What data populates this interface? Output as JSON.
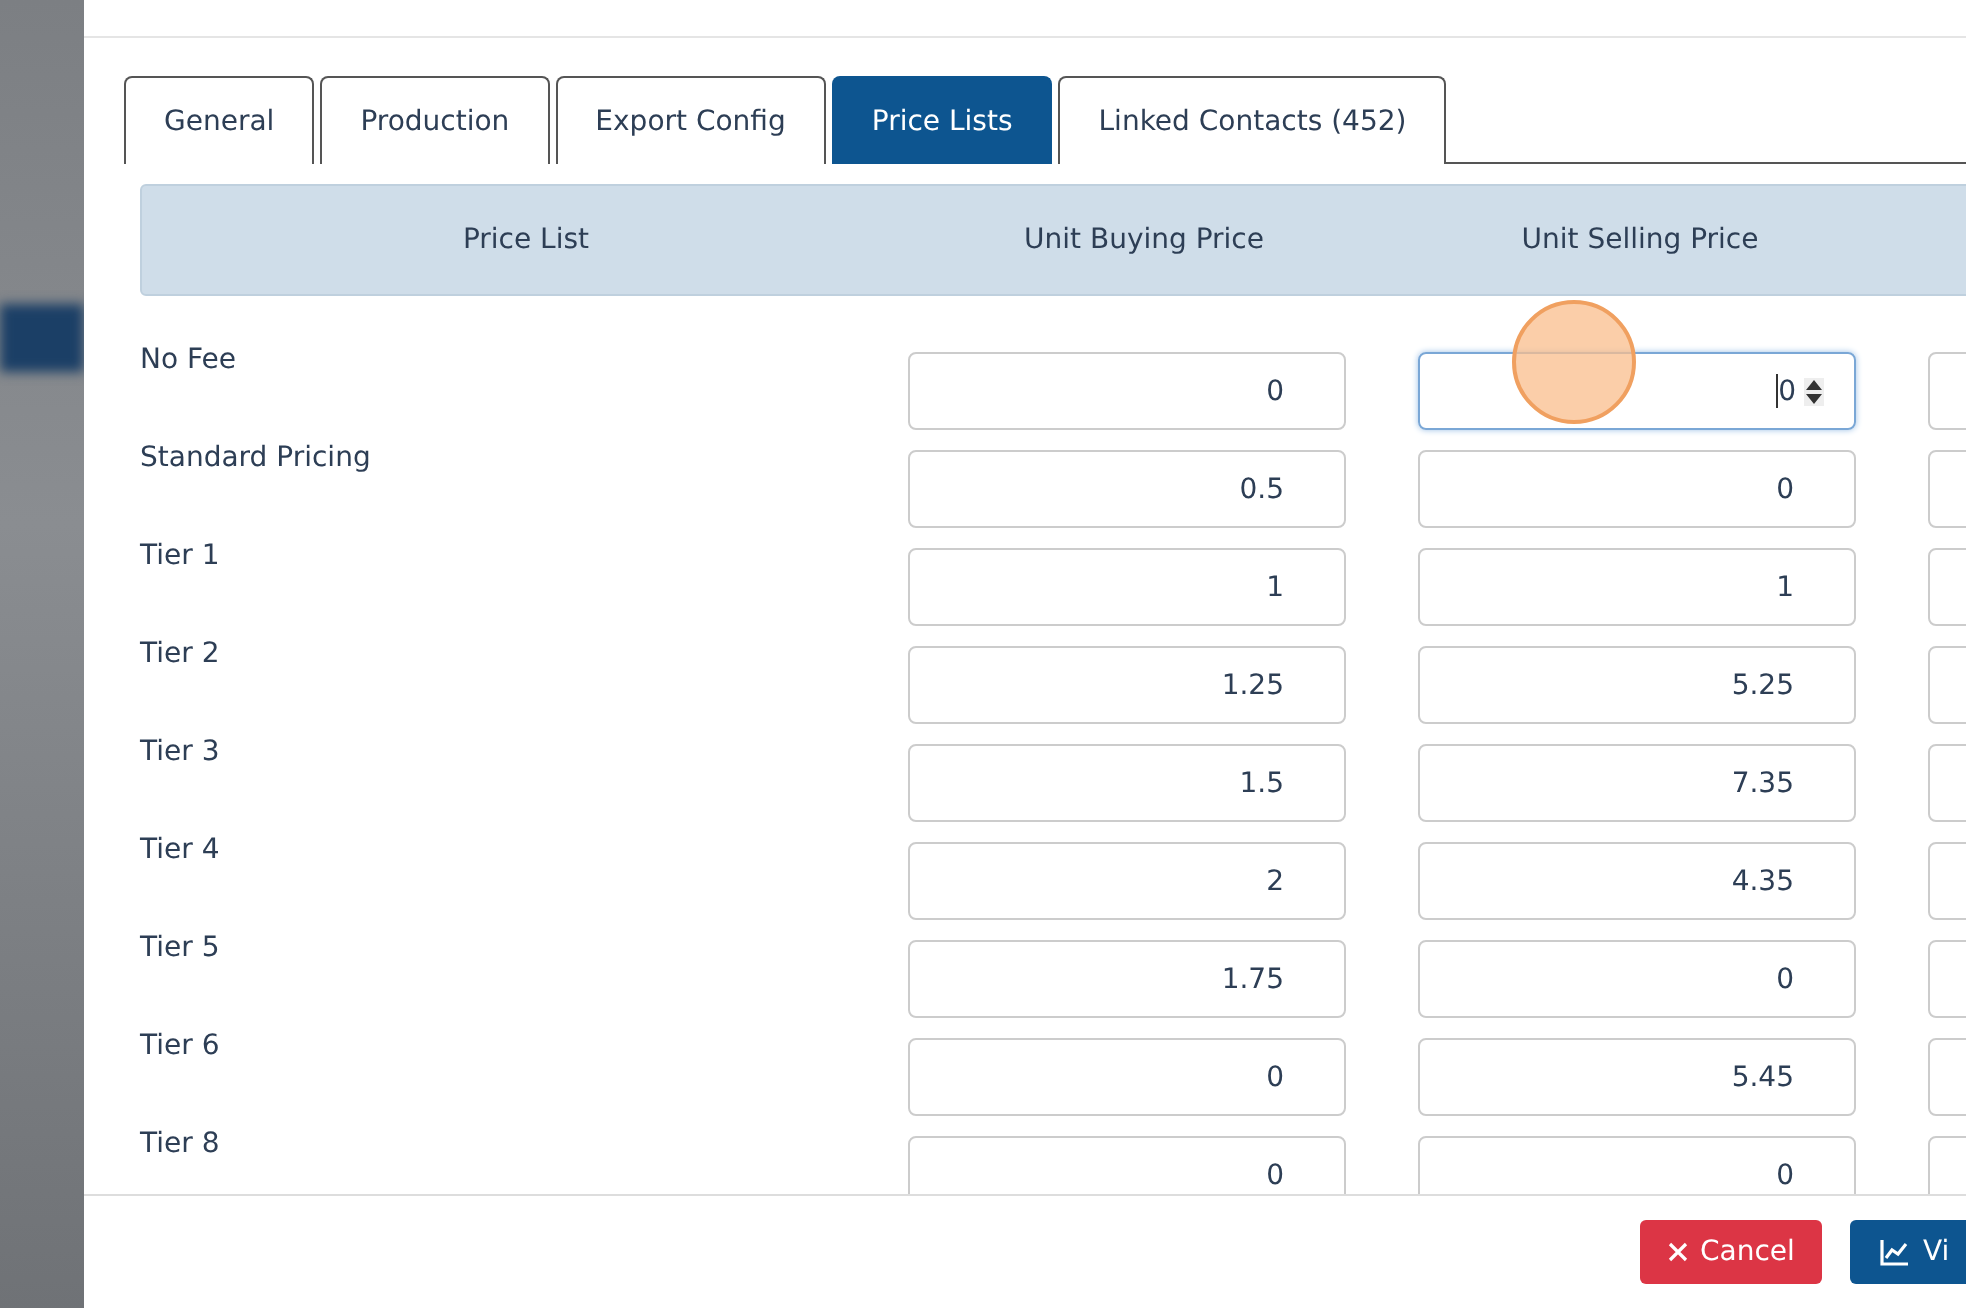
{
  "tabs": [
    {
      "label": "General",
      "selected": false
    },
    {
      "label": "Production",
      "selected": false
    },
    {
      "label": "Export Config",
      "selected": false
    },
    {
      "label": "Price Lists",
      "selected": true
    },
    {
      "label": "Linked Contacts (452)",
      "selected": false
    }
  ],
  "table": {
    "columns": [
      "Price List",
      "Unit Buying Price",
      "Unit Selling Price"
    ],
    "rows": [
      {
        "label": "No Fee",
        "buying": {
          "value": "0",
          "focused": false
        },
        "selling": {
          "value": "0",
          "focused": true
        }
      },
      {
        "label": "Standard Pricing",
        "buying": {
          "value": "0.5",
          "focused": false
        },
        "selling": {
          "value": "0",
          "focused": false
        }
      },
      {
        "label": "Tier 1",
        "buying": {
          "value": "1",
          "focused": false
        },
        "selling": {
          "value": "1",
          "focused": false
        }
      },
      {
        "label": "Tier 2",
        "buying": {
          "value": "1.25",
          "focused": false
        },
        "selling": {
          "value": "5.25",
          "focused": false
        }
      },
      {
        "label": "Tier 3",
        "buying": {
          "value": "1.5",
          "focused": false
        },
        "selling": {
          "value": "7.35",
          "focused": false
        }
      },
      {
        "label": "Tier 4",
        "buying": {
          "value": "2",
          "focused": false
        },
        "selling": {
          "value": "4.35",
          "focused": false
        }
      },
      {
        "label": "Tier 5",
        "buying": {
          "value": "1.75",
          "focused": false
        },
        "selling": {
          "value": "0",
          "focused": false
        }
      },
      {
        "label": "Tier 6",
        "buying": {
          "value": "0",
          "focused": false
        },
        "selling": {
          "value": "5.45",
          "focused": false
        }
      },
      {
        "label": "Tier 8",
        "buying": {
          "value": "0",
          "focused": false
        },
        "selling": {
          "value": "0",
          "focused": false
        }
      }
    ]
  },
  "footer": {
    "buttons": [
      {
        "kind": "cancel",
        "label": "Cancel"
      },
      {
        "kind": "view",
        "label": "Vi"
      }
    ]
  }
}
